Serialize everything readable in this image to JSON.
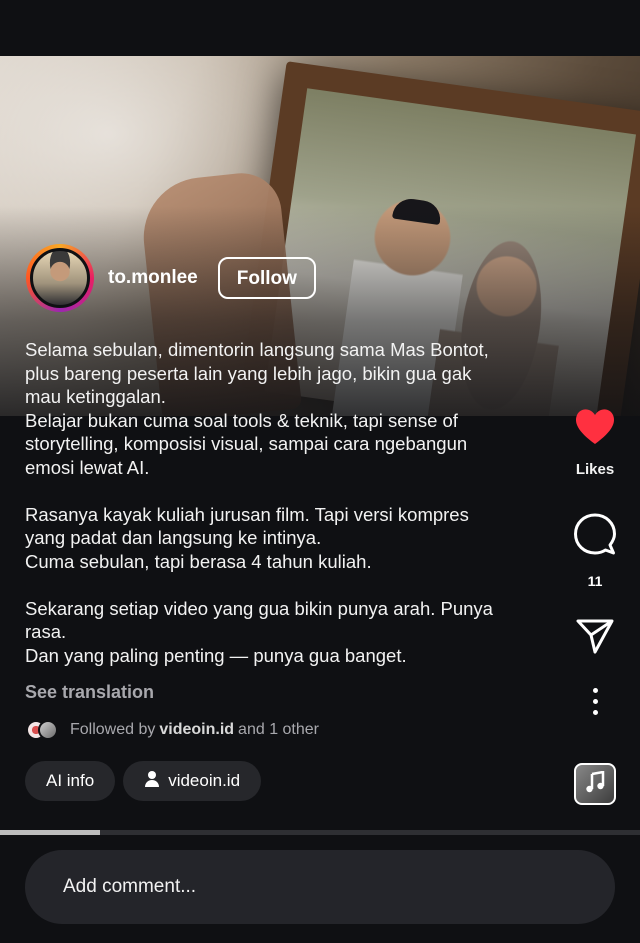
{
  "post": {
    "username": "to.monlee",
    "follow_label": "Follow",
    "caption_lines": [
      "Selama sebulan, dimentorin langsung sama Mas Bontot,",
      "plus bareng peserta lain yang lebih jago, bikin gua gak",
      "mau ketinggalan.",
      "Belajar bukan cuma soal tools & teknik, tapi sense of",
      "storytelling, komposisi visual, sampai cara ngebangun",
      "emosi lewat AI.",
      "",
      "Rasanya kayak kuliah jurusan film. Tapi versi kompres",
      "yang padat dan langsung ke intinya.",
      "Cuma sebulan, tapi berasa 4 tahun kuliah.",
      "",
      "Sekarang setiap video yang gua bikin punya arah. Punya",
      "rasa.",
      "Dan yang paling penting — punya gua banget."
    ],
    "see_translation": "See translation",
    "followed_prefix": "Followed by",
    "followed_user": "videoin.id",
    "followed_suffix": "and 1 other",
    "chips": {
      "ai_info": "AI info",
      "collab_user": "videoin.id"
    },
    "progress_fraction": 0.156
  },
  "actions": {
    "likes_label": "Likes",
    "comments_count": "11"
  },
  "comment_bar": {
    "placeholder": "Add comment..."
  },
  "colors": {
    "background": "#0f1013",
    "like_red": "#ff3040",
    "chip_bg": "#26272b"
  },
  "icons": [
    "heart-icon",
    "comment-icon",
    "share-icon",
    "more-icon",
    "music-icon",
    "user-icon"
  ]
}
